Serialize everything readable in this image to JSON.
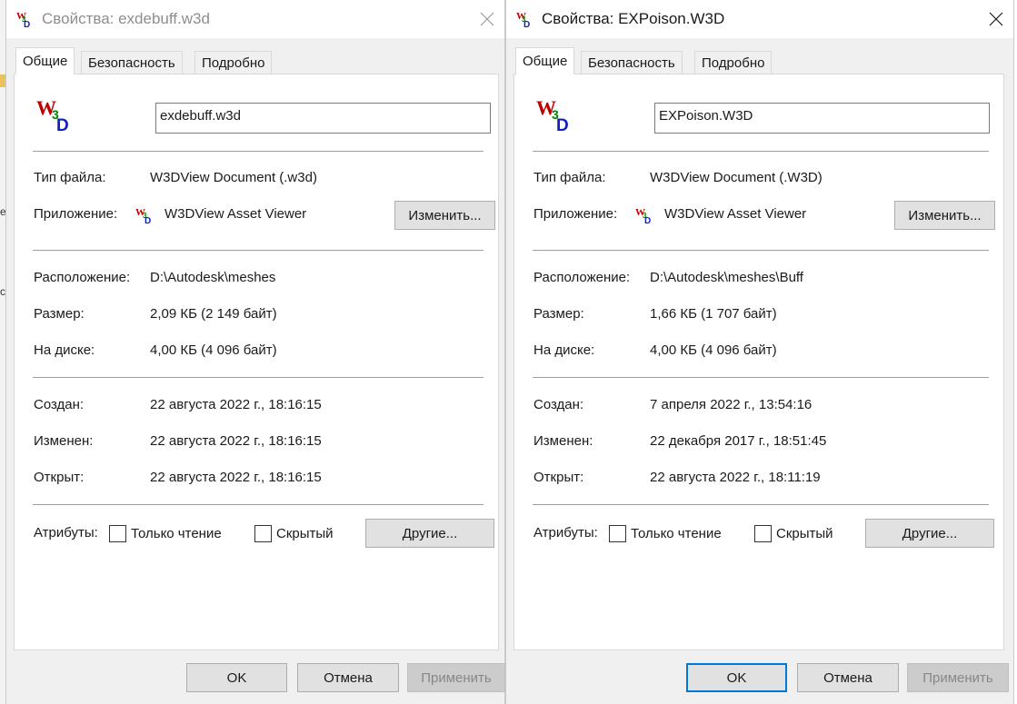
{
  "colors": {
    "accent": "#0078d7",
    "disabled_text": "#888888",
    "button_face": "#e1e1e1"
  },
  "windows": [
    {
      "title": "Свойства: exdebuff.w3d",
      "icon": "w3d-file-icon",
      "tabs": [
        {
          "label": "Общие",
          "active": true
        },
        {
          "label": "Безопасность",
          "active": false
        },
        {
          "label": "Подробно",
          "active": false
        }
      ],
      "filename": "exdebuff.w3d",
      "file_type_label": "Тип файла:",
      "file_type": "W3DView Document (.w3d)",
      "app_label": "Приложение:",
      "app_name": "W3DView Asset Viewer",
      "change_button": "Изменить...",
      "location_label": "Расположение:",
      "location": "D:\\Autodesk\\meshes",
      "size_label": "Размер:",
      "size": "2,09 КБ (2 149 байт)",
      "disk_label": "На диске:",
      "disk_size": "4,00 КБ (4 096 байт)",
      "created_label": "Создан:",
      "created": "22 августа 2022 г., 18:16:15",
      "modified_label": "Изменен:",
      "modified": "22 августа 2022 г., 18:16:15",
      "accessed_label": "Открыт:",
      "accessed": "22 августа 2022 г., 18:16:15",
      "attributes_label": "Атрибуты:",
      "readonly_label": "Только чтение",
      "readonly_checked": false,
      "hidden_label": "Скрытый",
      "hidden_checked": false,
      "other_button": "Другие...",
      "ok_button": "OK",
      "cancel_button": "Отмена",
      "apply_button": "Применить"
    },
    {
      "title": "Свойства: EXPoison.W3D",
      "icon": "w3d-file-icon",
      "tabs": [
        {
          "label": "Общие",
          "active": true
        },
        {
          "label": "Безопасность",
          "active": false
        },
        {
          "label": "Подробно",
          "active": false
        }
      ],
      "filename": "EXPoison.W3D",
      "file_type_label": "Тип файла:",
      "file_type": "W3DView Document (.W3D)",
      "app_label": "Приложение:",
      "app_name": "W3DView Asset Viewer",
      "change_button": "Изменить...",
      "location_label": "Расположение:",
      "location": "D:\\Autodesk\\meshes\\Buff",
      "size_label": "Размер:",
      "size": "1,66 КБ (1 707 байт)",
      "disk_label": "На диске:",
      "disk_size": "4,00 КБ (4 096 байт)",
      "created_label": "Создан:",
      "created": "7 апреля 2022 г., 13:54:16",
      "modified_label": "Изменен:",
      "modified": "22 декабря 2017 г., 18:51:45",
      "accessed_label": "Открыт:",
      "accessed": "22 августа 2022 г., 18:11:19",
      "attributes_label": "Атрибуты:",
      "readonly_label": "Только чтение",
      "readonly_checked": false,
      "hidden_label": "Скрытый",
      "hidden_checked": false,
      "other_button": "Другие...",
      "ok_button": "OK",
      "cancel_button": "Отмена",
      "apply_button": "Применить"
    }
  ]
}
